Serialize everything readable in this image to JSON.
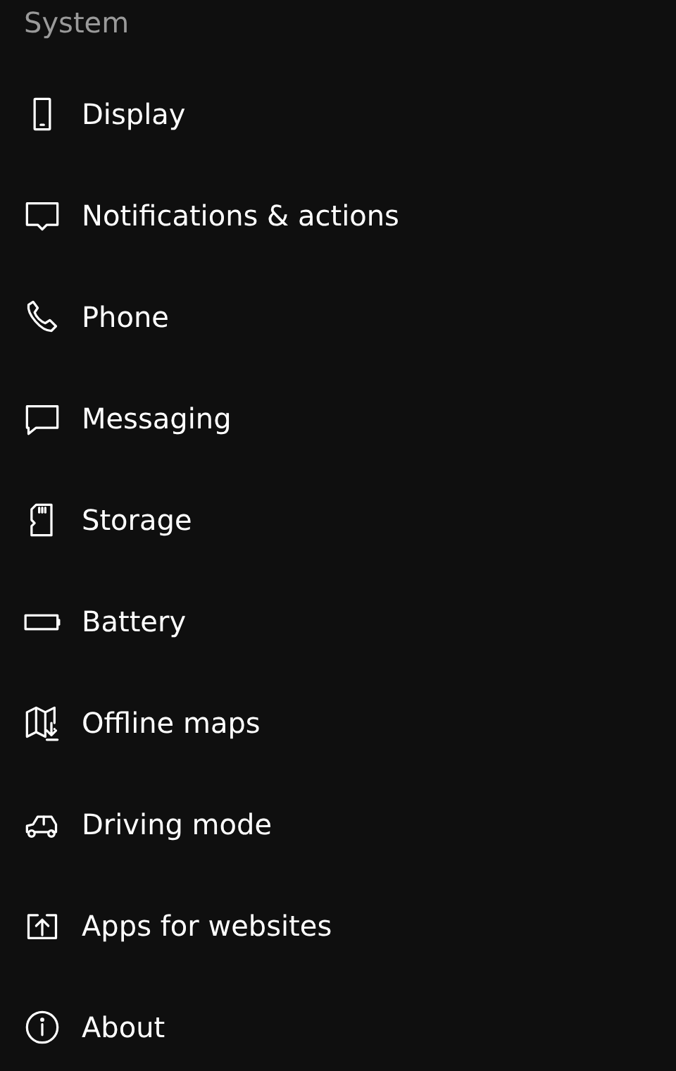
{
  "header": {
    "title": "System"
  },
  "items": [
    {
      "kind": "display",
      "label": "Display"
    },
    {
      "kind": "notifications",
      "label": "Notifications & actions"
    },
    {
      "kind": "phone",
      "label": "Phone"
    },
    {
      "kind": "messaging",
      "label": "Messaging"
    },
    {
      "kind": "storage",
      "label": "Storage"
    },
    {
      "kind": "battery",
      "label": "Battery"
    },
    {
      "kind": "maps",
      "label": "Offline maps"
    },
    {
      "kind": "driving",
      "label": "Driving mode"
    },
    {
      "kind": "apps",
      "label": "Apps for websites"
    },
    {
      "kind": "about",
      "label": "About"
    }
  ]
}
